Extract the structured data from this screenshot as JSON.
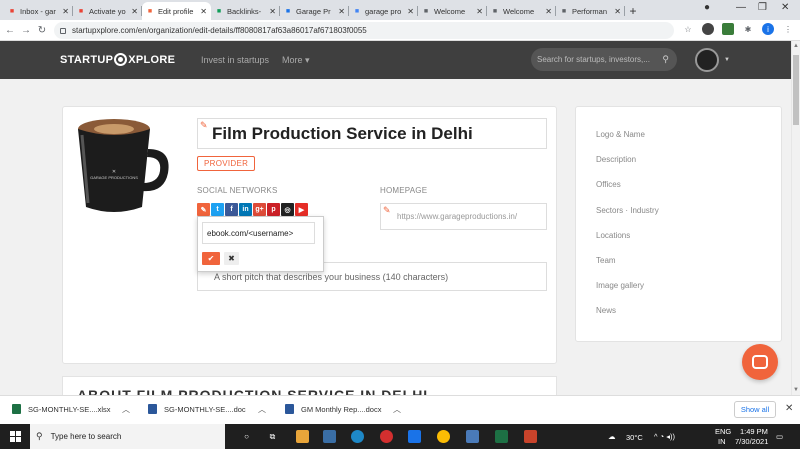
{
  "browser": {
    "tabs": [
      {
        "label": "Inbox - gar",
        "icon": "gmail-icon",
        "color": "#ea4335"
      },
      {
        "label": "Activate yo",
        "icon": "gmail-icon",
        "color": "#ea4335"
      },
      {
        "label": "Edit profile",
        "icon": "startupxplore-icon",
        "color": "#f0643c",
        "active": true
      },
      {
        "label": "Backlinks-",
        "icon": "sheets-icon",
        "color": "#0f9d58"
      },
      {
        "label": "Garage Pr",
        "icon": "garage-icon",
        "color": "#1a73e8"
      },
      {
        "label": "garage pro",
        "icon": "google-icon",
        "color": "#4285f4"
      },
      {
        "label": "Welcome",
        "icon": "wifi-icon",
        "color": "#5f6368"
      },
      {
        "label": "Welcome",
        "icon": "wifi-icon",
        "color": "#5f6368"
      },
      {
        "label": "Performan",
        "icon": "wifi-icon",
        "color": "#5f6368"
      }
    ],
    "url": "startupxplore.com/en/organization/edit-details/ff8080817af63a86017af671803f0055"
  },
  "site": {
    "logo_left": "STARTUP",
    "logo_right": "XPLORE",
    "nav": [
      "Invest in startups",
      "More ▾"
    ],
    "search_placeholder": "Search for startups, investors,..."
  },
  "profile": {
    "name": "Film Production Service in Delhi",
    "badge": "PROVIDER",
    "social_label": "SOCIAL NETWORKS",
    "homepage_label": "HOMEPAGE",
    "homepage_placeholder": "https://www.garageproductions.in/",
    "pitch_placeholder": "A short pitch that describes your business (140 characters)",
    "social_icons": [
      {
        "icon": "edit-icon",
        "glyph": "✎",
        "color": "#f0643c"
      },
      {
        "icon": "twitter-icon",
        "glyph": "t",
        "color": "#1da1f2"
      },
      {
        "icon": "facebook-icon",
        "glyph": "f",
        "color": "#3b5998"
      },
      {
        "icon": "linkedin-icon",
        "glyph": "in",
        "color": "#0077b5"
      },
      {
        "icon": "googleplus-icon",
        "glyph": "g+",
        "color": "#dd4b39"
      },
      {
        "icon": "pinterest-icon",
        "glyph": "p",
        "color": "#cb2027"
      },
      {
        "icon": "instagram-icon",
        "glyph": "◎",
        "color": "#222222"
      },
      {
        "icon": "youtube-icon",
        "glyph": "▶",
        "color": "#e52d27"
      }
    ]
  },
  "popup": {
    "value": "ebook.com/<username>",
    "confirm": "✔",
    "cancel": "✖"
  },
  "sidemenu": [
    "Logo & Name",
    "Description",
    "Offices",
    "Sectors · Industry",
    "Locations",
    "Team",
    "Image gallery",
    "News"
  ],
  "section_heading": "ABOUT FILM PRODUCTION SERVICE IN DELHI",
  "downloads": {
    "items": [
      "SG-MONTHLY-SE....xlsx",
      "SG-MONTHLY-SE....doc",
      "GM Monthly Rep....docx"
    ],
    "show_all": "Show all"
  },
  "taskbar": {
    "search": "Type here to search",
    "temp": "30°C",
    "lang_top": "ENG",
    "lang_bottom": "IN",
    "time": "1:49 PM",
    "date": "7/30/2021"
  },
  "colors": {
    "accent": "#f0643c",
    "header": "#3f3f3f"
  }
}
